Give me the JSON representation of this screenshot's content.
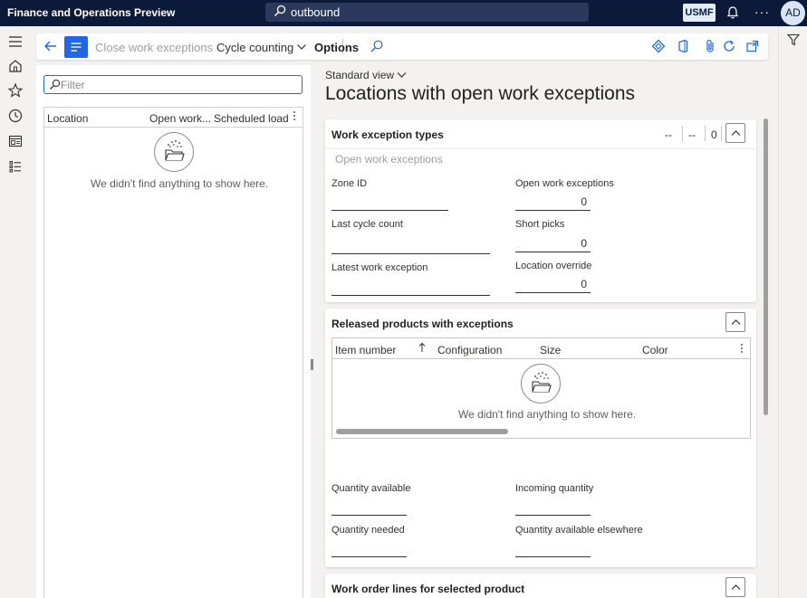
{
  "topbar": {
    "app_title": "Finance and Operations Preview",
    "search_value": "outbound",
    "company": "USMF",
    "more": "···",
    "avatar_initials": "AD"
  },
  "leftnav": {
    "icons": [
      "hamburger-icon",
      "home-icon",
      "star-icon",
      "clock-icon",
      "workspace-icon",
      "list-icon"
    ]
  },
  "actionpane": {
    "close_work_exceptions": "Close work exceptions",
    "cycle_counting": "Cycle counting",
    "options": "Options"
  },
  "left_grid": {
    "filter_placeholder": "Filter",
    "columns": [
      "Location",
      "Open work...",
      "Scheduled load"
    ],
    "empty_message": "We didn't find anything to show here."
  },
  "content": {
    "view_selector": "Standard view",
    "page_title": "Locations with open work exceptions"
  },
  "work_exception_types": {
    "title": "Work exception types",
    "summary": [
      "--",
      "--",
      "0"
    ],
    "section_label": "Open work exceptions",
    "fields": {
      "zone_id": {
        "label": "Zone ID",
        "value": ""
      },
      "last_cycle_count": {
        "label": "Last cycle count",
        "value": ""
      },
      "latest_work_exception": {
        "label": "Latest work exception",
        "value": ""
      },
      "open_work_exceptions": {
        "label": "Open work exceptions",
        "value": "0"
      },
      "short_picks": {
        "label": "Short picks",
        "value": "0"
      },
      "location_override": {
        "label": "Location override",
        "value": "0"
      }
    }
  },
  "released_products": {
    "title": "Released products with exceptions",
    "columns": [
      "Item number",
      "Configuration",
      "Size",
      "Color"
    ],
    "empty_message": "We didn't find anything to show here.",
    "fields": {
      "quantity_available": {
        "label": "Quantity available",
        "value": ""
      },
      "quantity_needed": {
        "label": "Quantity needed",
        "value": ""
      },
      "incoming_quantity": {
        "label": "Incoming quantity",
        "value": ""
      },
      "quantity_available_elsewhere": {
        "label": "Quantity available elsewhere",
        "value": ""
      }
    }
  },
  "work_order_lines": {
    "title": "Work order lines for selected product"
  },
  "colors": {
    "topbar": "#0c1a39",
    "accent": "#2266e3"
  }
}
